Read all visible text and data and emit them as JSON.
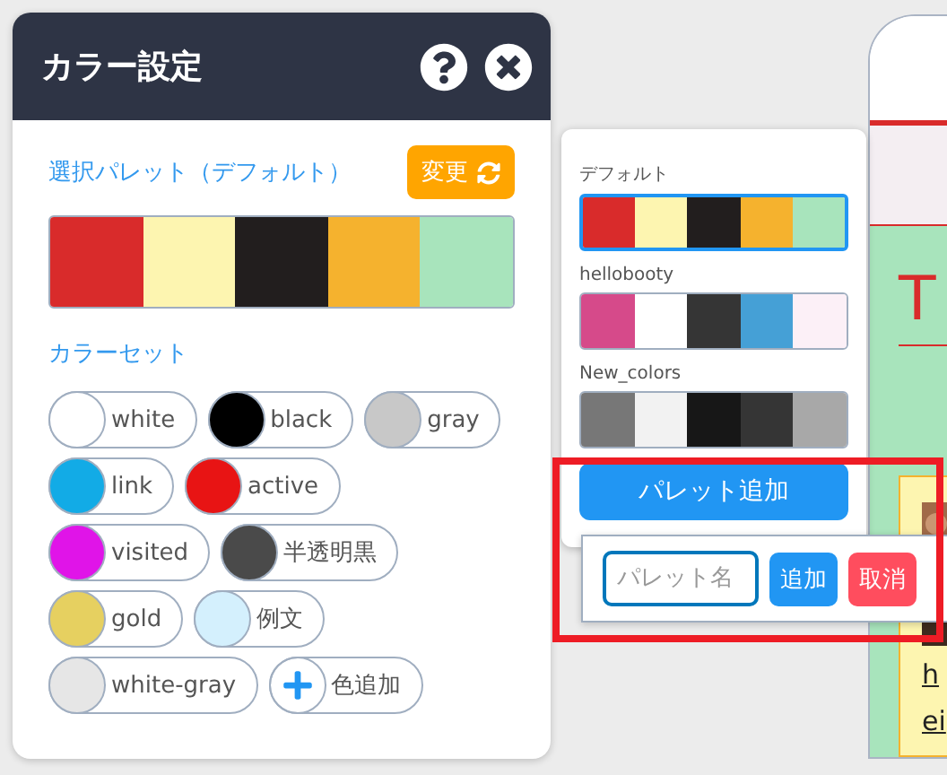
{
  "dialog": {
    "title": "カラー設定",
    "selected_palette": {
      "label": "選択パレット（デフォルト）",
      "change_button": "変更",
      "colors": [
        {
          "color": "#d92b2b"
        },
        {
          "color": "#fdf5b0"
        },
        {
          "color": "#221e1e"
        },
        {
          "color": "#f5b22e"
        },
        {
          "color": "#a8e4bc"
        }
      ]
    },
    "color_set": {
      "label": "カラーセット",
      "colors": [
        {
          "name": "white",
          "color": "#ffffff"
        },
        {
          "name": "black",
          "color": "#000000"
        },
        {
          "name": "gray",
          "color": "#c8c8c8"
        },
        {
          "name": "link",
          "color": "#12abe6"
        },
        {
          "name": "active",
          "color": "#e81414"
        },
        {
          "name": "visited",
          "color": "#e014e8"
        },
        {
          "name": "半透明黒",
          "color": "#4a4a4a"
        },
        {
          "name": "gold",
          "color": "#e6d060"
        },
        {
          "name": "例文",
          "color": "#d4f0fd"
        },
        {
          "name": "white-gray",
          "color": "#e6e6e6"
        }
      ],
      "add_button": "色追加"
    }
  },
  "palette_menu": {
    "palettes": [
      {
        "name": "デフォルト",
        "selected": true,
        "colors": [
          {
            "color": "#d92b2b"
          },
          {
            "color": "#fdf5b0"
          },
          {
            "color": "#221e1e"
          },
          {
            "color": "#f5b22e"
          },
          {
            "color": "#a8e4bc"
          }
        ]
      },
      {
        "name": "hellobooty",
        "selected": false,
        "colors": [
          {
            "color": "#d64a8a"
          },
          {
            "color": "#ffffff"
          },
          {
            "color": "#353535"
          },
          {
            "color": "#45a0d6"
          },
          {
            "color": "#fcf0f7"
          }
        ]
      },
      {
        "name": "New_colors",
        "selected": false,
        "colors": [
          {
            "color": "#777777"
          },
          {
            "color": "#f2f2f2"
          },
          {
            "color": "#171717"
          },
          {
            "color": "#353535"
          },
          {
            "color": "#a8a8a8"
          }
        ]
      }
    ],
    "add_button": "パレット追加"
  },
  "add_form": {
    "placeholder": "パレット名",
    "add_button": "追加",
    "cancel_button": "取消"
  },
  "preview": {
    "heading": "T",
    "links": [
      "h",
      "ei"
    ]
  }
}
